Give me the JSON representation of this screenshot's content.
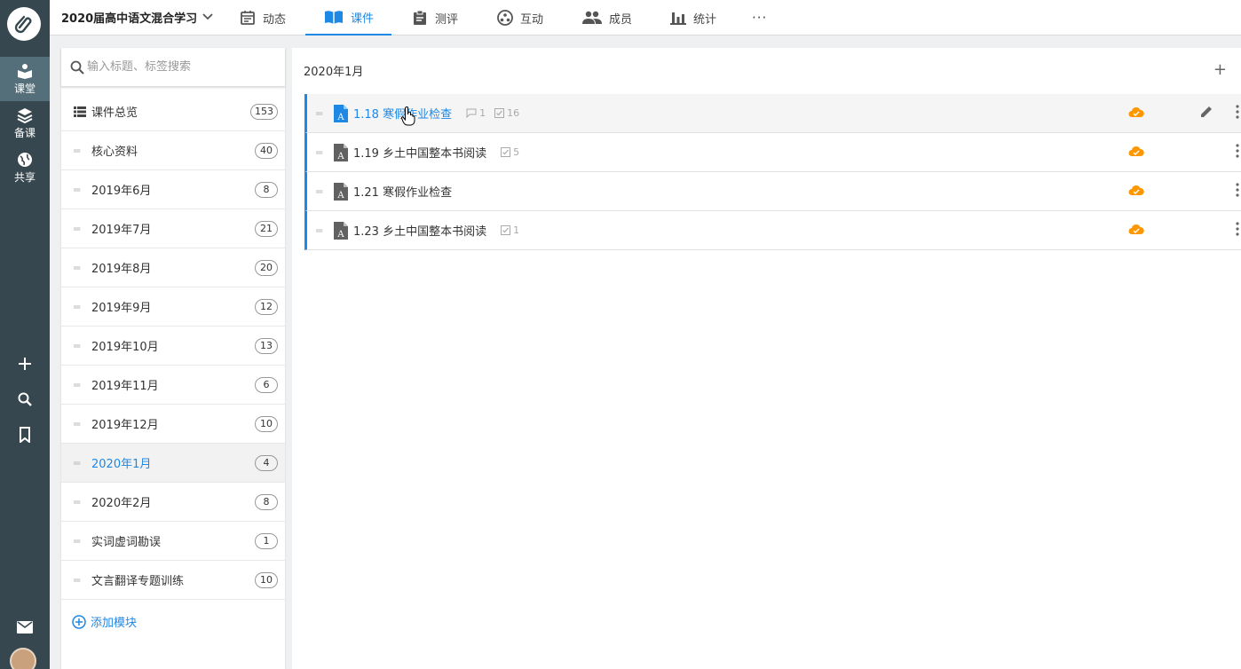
{
  "course": {
    "title": "2020届高中语文混合学习"
  },
  "nav": {
    "tabs": [
      {
        "label": "动态"
      },
      {
        "label": "课件"
      },
      {
        "label": "测评"
      },
      {
        "label": "互动"
      },
      {
        "label": "成员"
      },
      {
        "label": "统计"
      }
    ],
    "more": "···"
  },
  "rail": {
    "items": [
      {
        "label": "课堂"
      },
      {
        "label": "备课"
      },
      {
        "label": "共享"
      }
    ]
  },
  "search": {
    "placeholder": "输入标题、标签搜索"
  },
  "modules": [
    {
      "label": "课件总览",
      "count": "153"
    },
    {
      "label": "核心资料",
      "count": "40"
    },
    {
      "label": "2019年6月",
      "count": "8"
    },
    {
      "label": "2019年7月",
      "count": "21"
    },
    {
      "label": "2019年8月",
      "count": "20"
    },
    {
      "label": "2019年9月",
      "count": "12"
    },
    {
      "label": "2019年10月",
      "count": "13"
    },
    {
      "label": "2019年11月",
      "count": "6"
    },
    {
      "label": "2019年12月",
      "count": "10"
    },
    {
      "label": "2020年1月",
      "count": "4"
    },
    {
      "label": "2020年2月",
      "count": "8"
    },
    {
      "label": "实词虚词勘误",
      "count": "1"
    },
    {
      "label": "文言翻译专题训练",
      "count": "10"
    }
  ],
  "add_module": "添加模块",
  "main": {
    "heading": "2020年1月",
    "plus": "+",
    "items": [
      {
        "title": "1.18 寒假作业检查",
        "comments": "1",
        "tasks": "16"
      },
      {
        "title": "1.19 乡土中国整本书阅读",
        "tasks": "5"
      },
      {
        "title": "1.21 寒假作业检查"
      },
      {
        "title": "1.23 乡土中国整本书阅读",
        "tasks": "1"
      }
    ]
  },
  "colors": {
    "accent": "#1e88e5",
    "rail": "#37474f",
    "cloud": "#ff9800"
  }
}
